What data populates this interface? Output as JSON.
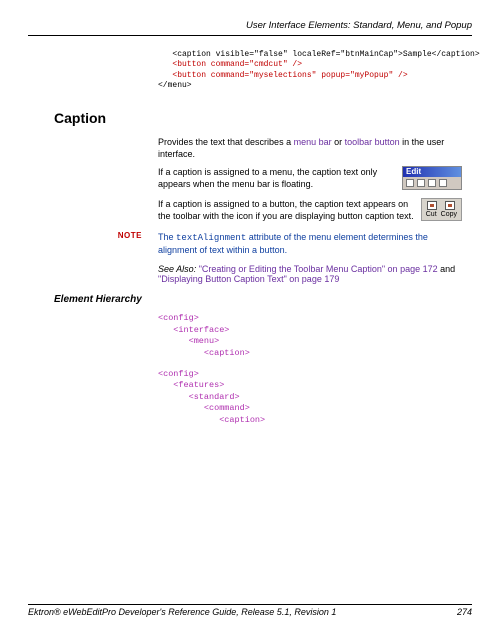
{
  "header": {
    "title": "User Interface Elements: Standard, Menu, and Popup"
  },
  "code_top": {
    "l1_pre": "   <caption visible=\"false\" localeRef=\"btnMainCap\">Sample</caption>",
    "l2_red": "   <button command=\"cmdcut\" />",
    "l3_red": "   <button command=\"myselections\" popup=\"myPopup\" />",
    "l4": "</menu>"
  },
  "section": {
    "caption_heading": "Caption"
  },
  "para1": {
    "pre": "Provides the text that describes a ",
    "link1": "menu bar",
    "mid": " or ",
    "link2": "toolbar button",
    "post": " in the user interface."
  },
  "para2": {
    "pre": "If a caption is assigned to a menu, the caption text only appears when the menu bar is floating."
  },
  "menu_img": {
    "label": "Edit"
  },
  "para3": {
    "text": "If a caption is assigned to a button, the caption text appears on the toolbar with the icon if you are displaying button caption text."
  },
  "tb_img": {
    "l1": "Cut",
    "l2": "Copy"
  },
  "note": {
    "label": "NOTE",
    "pre": "The ",
    "code": "textAlignment",
    "post": " attribute of the menu element determines the alignment of text within a button."
  },
  "seealso": {
    "label": "See Also:",
    "q1": "\"Creating or Editing the Toolbar Menu Caption\" on page 172",
    "mid": " and ",
    "q2": "\"Displaying Button Caption Text\" on page 179"
  },
  "sub": {
    "heading": "Element Hierarchy"
  },
  "hier1": "<config>\n   <interface>\n      <menu>\n         <caption>",
  "hier2": "<config>\n   <features>\n      <standard>\n         <command>\n            <caption>",
  "footer": {
    "left": "Ektron® eWebEditPro Developer's Reference Guide, Release 5.1, Revision 1",
    "right": "274"
  }
}
